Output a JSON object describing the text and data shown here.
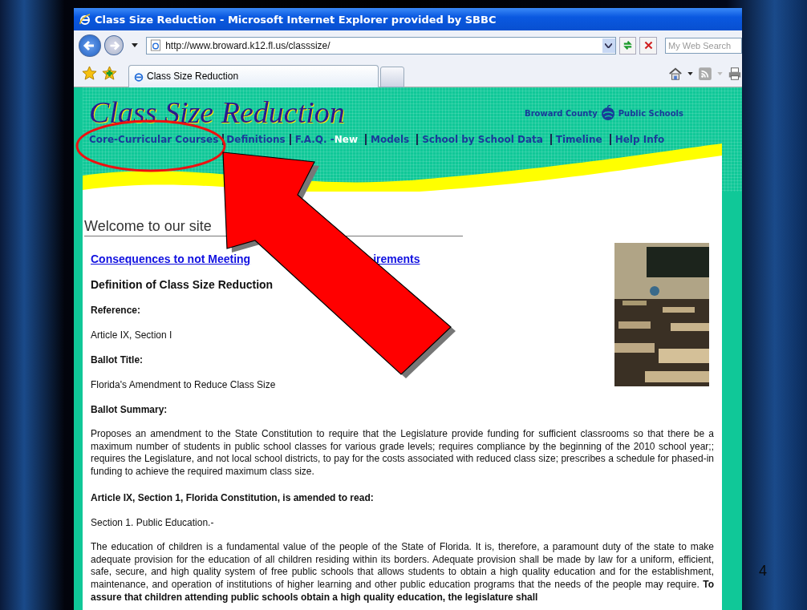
{
  "window": {
    "title": "Class Size Reduction - Microsoft Internet Explorer provided by SBBC"
  },
  "toolbar": {
    "address": "http://www.broward.k12.fl.us/classsize/",
    "search": {
      "placeholder": "My Web Search"
    }
  },
  "tabs": [
    {
      "label": "Class Size Reduction",
      "selected": true
    }
  ],
  "site": {
    "title": "Class Size Reduction",
    "brand_left": "Broward County",
    "brand_right": "Public Schools",
    "nav": [
      {
        "label": "Core-Curricular Courses"
      },
      {
        "label": "Definitions"
      },
      {
        "label": "F.A.Q. -",
        "badge": "New"
      },
      {
        "label": "Models"
      },
      {
        "label": "School by School Data"
      },
      {
        "label": "Timeline"
      },
      {
        "label": "Help Info"
      }
    ]
  },
  "content": {
    "heading": "Welcome to our site",
    "link_parts": [
      "Consequences to not Meeting",
      "irements"
    ],
    "blocks": [
      {
        "kind": "title",
        "text": "Definition of Class Size Reduction"
      },
      {
        "kind": "label",
        "text": "Reference:"
      },
      {
        "kind": "text",
        "text": "Article IX, Section I"
      },
      {
        "kind": "label",
        "text": "Ballot Title:"
      },
      {
        "kind": "text",
        "text": "Florida's Amendment to Reduce Class Size"
      },
      {
        "kind": "label",
        "text": "Ballot Summary:"
      },
      {
        "kind": "paragraph",
        "text": "Proposes an amendment to the State Constitution to require that the Legislature provide funding for sufficient classrooms so that there be a maximum number of students in public school classes for various grade levels; requires compliance by the beginning of the 2010 school year;; requires the Legislature, and not local school districts, to pay for the costs associated with reduced class size; prescribes a schedule for phased-in funding to achieve the required maximum class size."
      },
      {
        "kind": "label",
        "text": "Article IX, Section 1, Florida Constitution, is amended to read:"
      },
      {
        "kind": "text",
        "text": "Section 1. Public Education.-"
      },
      {
        "kind": "paragraph",
        "text": "The education of children is a fundamental value of the people of the State of Florida. It is, therefore, a paramount duty of the state to make adequate provision for the education of all children residing within its borders. Adequate provision shall be made by law for a uniform, efficient, safe, secure, and high quality system of free public schools that allows students to obtain a high quality education and for the establishment, maintenance, and operation of institutions of higher learning and other public education programs that the needs of the people may require. **To assure that children attending public schools obtain a high quality education, the legislature shall**"
      }
    ]
  },
  "slide_number": "4"
}
